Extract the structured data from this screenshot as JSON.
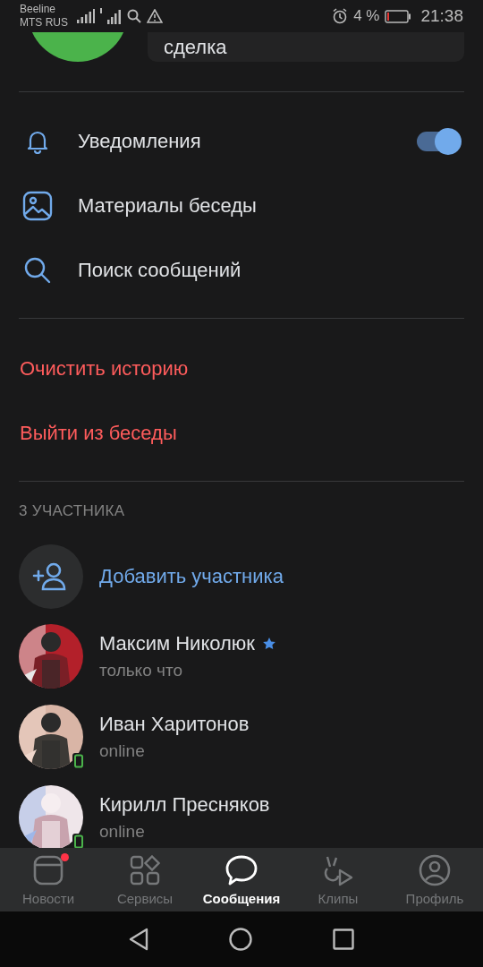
{
  "status_bar": {
    "carrier_1": "Beeline",
    "carrier_2": "MTS RUS",
    "battery": "4 %",
    "time": "21:38"
  },
  "header_card": {
    "text": "сделка"
  },
  "menu": [
    {
      "label": "Уведомления",
      "toggle": {
        "on": true
      }
    },
    {
      "label": "Материалы беседы"
    },
    {
      "label": "Поиск сообщений"
    }
  ],
  "danger_actions": [
    "Очистить историю",
    "Выйти из беседы"
  ],
  "members": {
    "title": "3 УЧАСТНИКА",
    "add_label": "Добавить участника",
    "list": [
      {
        "name": "Максим Николюк",
        "status": "только что",
        "starred": true,
        "online_mobile": false
      },
      {
        "name": "Иван Харитонов",
        "status": "online",
        "starred": false,
        "online_mobile": true
      },
      {
        "name": "Кирилл Пресняков",
        "status": "online",
        "starred": false,
        "online_mobile": true
      }
    ]
  },
  "tab_bar": [
    {
      "label": "Новости",
      "selected": false,
      "badge": true
    },
    {
      "label": "Сервисы",
      "selected": false,
      "badge": false
    },
    {
      "label": "Сообщения",
      "selected": true,
      "badge": false
    },
    {
      "label": "Клипы",
      "selected": false,
      "badge": false
    },
    {
      "label": "Профиль",
      "selected": false,
      "badge": false
    }
  ]
}
